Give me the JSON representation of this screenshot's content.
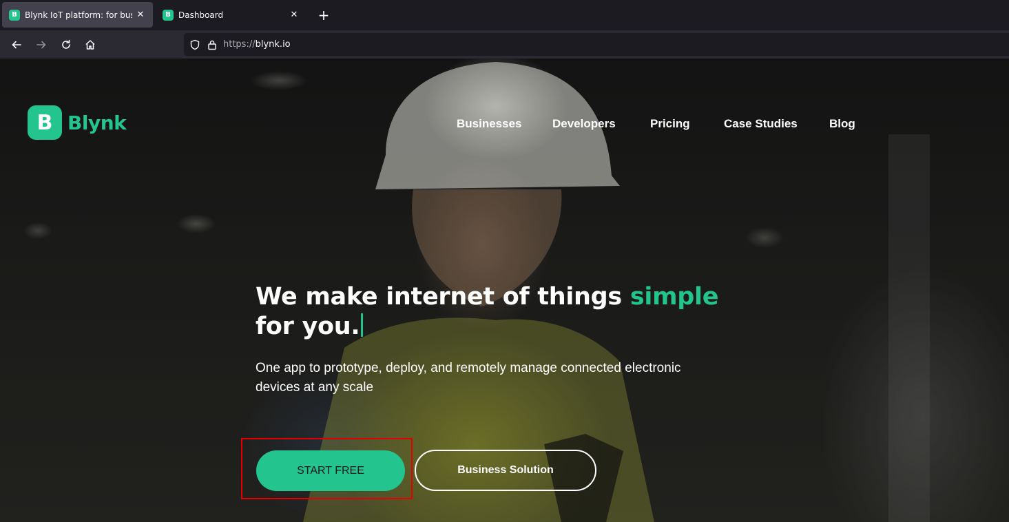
{
  "browser": {
    "tabs": [
      {
        "title": "Blynk IoT platform: for businesses",
        "favicon": "B",
        "active": true
      },
      {
        "title": "Dashboard",
        "favicon": "B",
        "active": false
      }
    ],
    "new_tab_label": "+",
    "close_label": "✕",
    "url_scheme": "https://",
    "url_host": "blynk.io"
  },
  "page": {
    "logo_letter": "B",
    "logo_text": "Blynk",
    "nav": [
      "Businesses",
      "Developers",
      "Pricing",
      "Case Studies",
      "Blog"
    ],
    "headline_part1": "We make internet of things ",
    "headline_accent": "simple",
    "headline_part2": "for you.",
    "subtext": "One app to prototype, deploy, and remotely manage connected electronic devices at any scale",
    "start_button": "START FREE",
    "business_button": "Business Solution"
  },
  "colors": {
    "brand": "#23c48e",
    "highlight": "#e30000"
  }
}
